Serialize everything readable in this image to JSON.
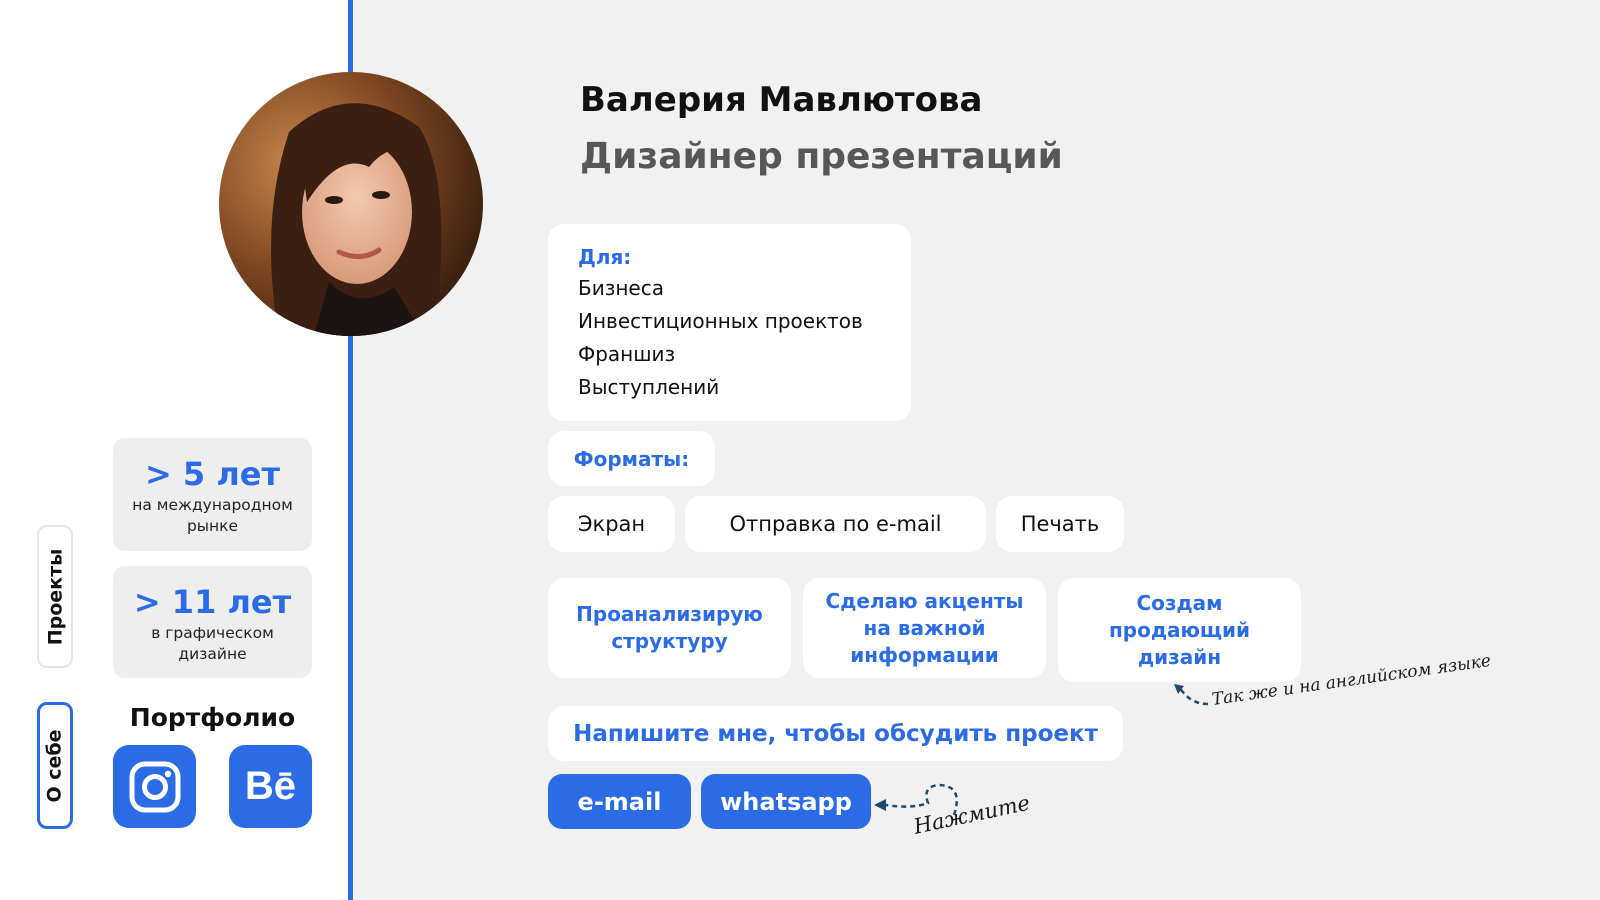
{
  "profile": {
    "name": "Валерия Мавлютова",
    "role": "Дизайнер презентаций"
  },
  "sidebar": {
    "tabs": [
      {
        "label": "Проекты",
        "active": false
      },
      {
        "label": "О себе",
        "active": true
      }
    ],
    "stats": [
      {
        "value": "> 5 лет",
        "caption": "на международном рынке"
      },
      {
        "value": "> 11 лет",
        "caption": "в графическом дизайне"
      }
    ],
    "portfolio": {
      "title": "Портфолио",
      "links": [
        {
          "icon": "instagram-icon"
        },
        {
          "icon": "behance-icon",
          "label": "Bē"
        }
      ]
    }
  },
  "for_block": {
    "title": "Для:",
    "items": [
      "Бизнеса",
      "Инвестиционных проектов",
      "Франшиз",
      "Выступлений"
    ]
  },
  "formats": {
    "label": "Форматы:",
    "chips": [
      "Экран",
      "Отправка по e-mail",
      "Печать"
    ]
  },
  "features": [
    "Проанализирую структуру",
    "Сделаю акценты на важной информации",
    "Создам продающий дизайн"
  ],
  "notes": {
    "english": "Так же и на английском языке",
    "click": "Нажмите"
  },
  "contact": {
    "cta": "Напишите мне, чтобы обсудить проект",
    "buttons": [
      "e-mail",
      "whatsapp"
    ]
  },
  "colors": {
    "accent": "#2b6ce6",
    "background": "#f1f1f1",
    "card": "#ffffff",
    "subtitle": "#575757"
  }
}
